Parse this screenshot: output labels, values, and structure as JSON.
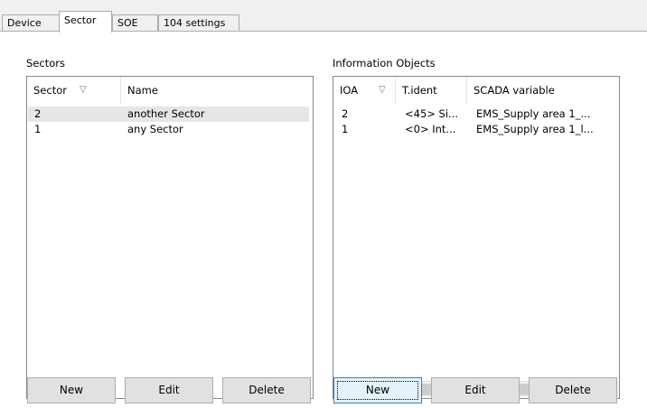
{
  "tabs": [
    {
      "label": "Device"
    },
    {
      "label": "Sector"
    },
    {
      "label": "SOE"
    },
    {
      "label": "104 settings"
    }
  ],
  "sectors": {
    "title": "Sectors",
    "columns": [
      "Sector",
      "Name"
    ],
    "rows": [
      {
        "sector": "2",
        "name": "another Sector"
      },
      {
        "sector": "1",
        "name": "any Sector"
      }
    ],
    "buttons": {
      "new": "New",
      "edit": "Edit",
      "delete": "Delete"
    }
  },
  "info_objects": {
    "title": "Information Objects",
    "columns": [
      "IOA",
      "T.ident",
      "SCADA variable"
    ],
    "rows": [
      {
        "ioa": "2",
        "tident": "<45> Si...",
        "scada": "EMS_Supply area 1_..."
      },
      {
        "ioa": "1",
        "tident": "<0> Int...",
        "scada": "EMS_Supply area 1_l..."
      }
    ],
    "buttons": {
      "new": "New",
      "edit": "Edit",
      "delete": "Delete"
    }
  },
  "icons": {
    "sort": "sort-triangle-icon",
    "scroll_left": "scroll-left-icon",
    "scroll_right": "scroll-right-icon"
  },
  "colors": {
    "selection": "#e6e6e6",
    "border": "#828790",
    "focus": "#3c7fb1"
  }
}
